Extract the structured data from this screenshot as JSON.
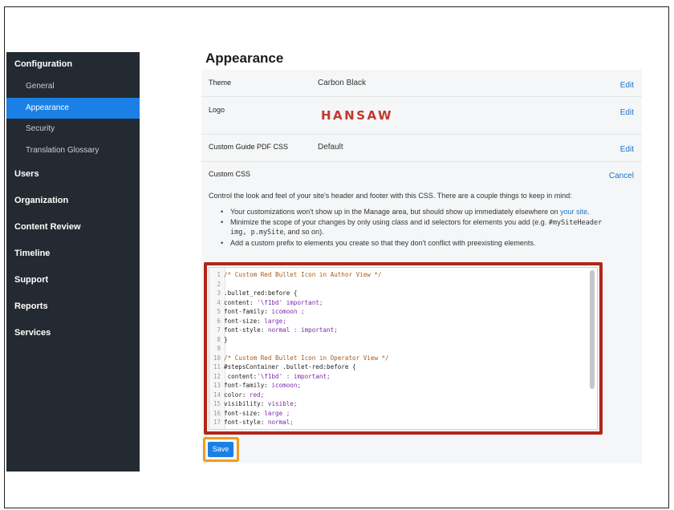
{
  "sidebar": {
    "sections": [
      {
        "label": "Configuration",
        "items": [
          "General",
          "Appearance",
          "Security",
          "Translation Glossary"
        ]
      },
      {
        "label": "Users"
      },
      {
        "label": "Organization"
      },
      {
        "label": "Content Review"
      },
      {
        "label": "Timeline"
      },
      {
        "label": "Support"
      },
      {
        "label": "Reports"
      },
      {
        "label": "Services"
      }
    ],
    "active_item": "Appearance"
  },
  "page": {
    "title": "Appearance"
  },
  "settings": {
    "theme": {
      "label": "Theme",
      "value": "Carbon Black",
      "action": "Edit"
    },
    "logo": {
      "label": "Logo",
      "value": "HANSAW",
      "action": "Edit"
    },
    "pdf_css": {
      "label": "Custom Guide PDF CSS",
      "value": "Default",
      "action": "Edit"
    },
    "custom_css": {
      "label": "Custom CSS",
      "action": "Cancel"
    }
  },
  "description": {
    "intro": "Control the look and feel of your site's header and footer with this CSS. There are a couple things to keep in mind:",
    "bullet1_a": "Your customizations won't show up in the Manage area, but should show up immediately elsewhere on ",
    "bullet1_link": "your site",
    "bullet1_b": ".",
    "bullet2_a": "Minimize the scope of your changes by only using class and id selectors for elements you add (e.g. ",
    "bullet2_code": "#mySiteHeader img, p.mySite",
    "bullet2_b": ", and so on).",
    "bullet3": "Add a custom prefix to elements you create so that they don't conflict with preexisting elements."
  },
  "code_lines": [
    "/* Custom Red Bullet Icon in Author View */",
    "",
    ".bullet_red:before {",
    "content: '\\f1bd' important;",
    "font-family: icomoon ;",
    "font-size: large;",
    "font-style: normal : important;",
    "}",
    "",
    "/* Custom Red Bullet Icon in Operator View */",
    "#stepsContainer .bullet-red:before {",
    " content:'\\f1bd' : important;",
    "font-family: icomoon;",
    "color: red;",
    "visibility: visible;",
    "font-size: large ;",
    "font-style: normal;"
  ],
  "save_label": "Save",
  "colors": {
    "sidebar_bg": "#232a31",
    "accent": "#1a80e6",
    "editor_highlight": "#b0261a",
    "save_highlight": "#f29b1e",
    "logo": "#c0392b"
  }
}
